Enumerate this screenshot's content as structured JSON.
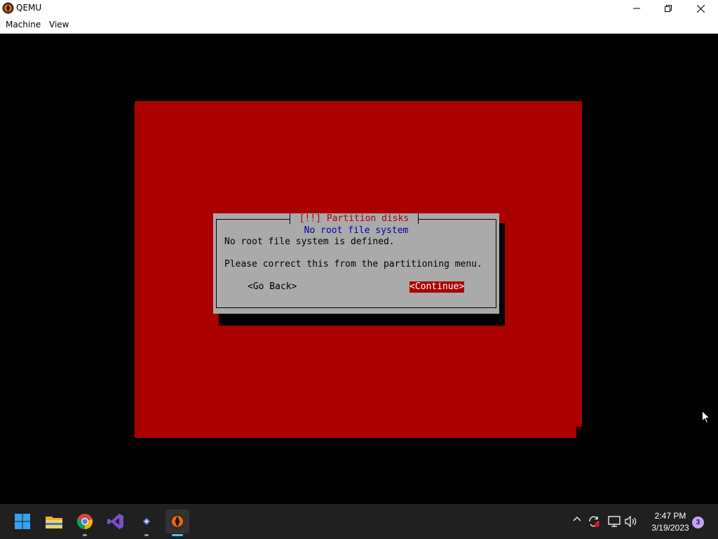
{
  "window": {
    "title": "QEMU",
    "icon": "qemu-icon",
    "controls": [
      "minimize-icon",
      "restore-icon",
      "close-icon"
    ]
  },
  "menubar": {
    "items": [
      {
        "label": "Machine"
      },
      {
        "label": "View"
      }
    ]
  },
  "installer": {
    "background_color": "#aa0000",
    "dialog": {
      "title": "[!!] Partition disks",
      "subtitle": "No root file system",
      "line1": "No root file system is defined.",
      "line2": "Please correct this from the partitioning menu.",
      "buttons": {
        "go_back": "<Go Back>",
        "continue": "<Continue>"
      },
      "selected_button": "continue",
      "colors": {
        "dialog_bg": "#aaaaaa",
        "title": "#aa0000",
        "subtitle": "#0000aa",
        "selected_bg": "#aa0000"
      }
    }
  },
  "taskbar": {
    "apps": [
      {
        "name": "start-icon"
      },
      {
        "name": "file-explorer-icon"
      },
      {
        "name": "chrome-icon"
      },
      {
        "name": "visual-studio-icon"
      },
      {
        "name": "teams-icon"
      },
      {
        "name": "qemu-icon"
      }
    ],
    "tray": {
      "icons": [
        "chevron-up-icon",
        "sync-icon",
        "network-icon",
        "volume-icon"
      ],
      "time": "2:47 PM",
      "date": "3/19/2023",
      "notification_count": "3"
    }
  }
}
